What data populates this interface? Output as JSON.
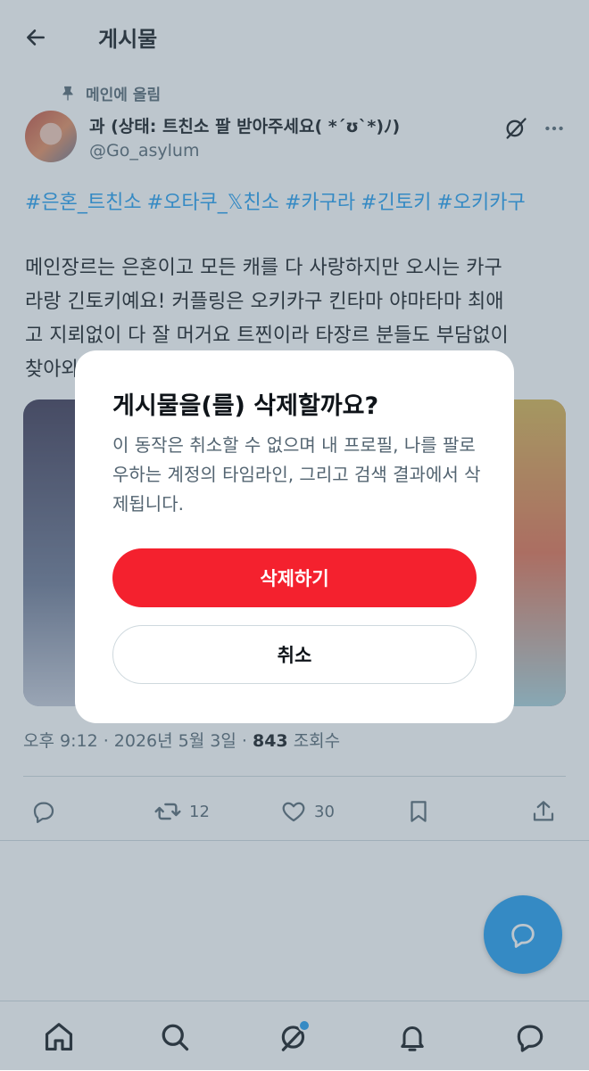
{
  "header": {
    "title": "게시물"
  },
  "post": {
    "pinned_label": "메인에 올림",
    "display_name": "과 (상태: 트친소 팔 받아주세요( *´ʊ`*)ﾉ)",
    "handle": "@Go_asylum",
    "hashtags": [
      "#은혼_트친소",
      "#오타쿠_𝕏친소",
      "#카구라",
      "#긴토키",
      "#오키카구"
    ],
    "body_lines": [
      "메인장르는 은혼이고 모든 캐를 다 사랑하지만 오시는 카구",
      "라랑 긴토키예요! 커플링은 오키카구 킨타마 야마타마 최애",
      "고 지뢰없이 다 잘 머거요 트찐이라 타장르 분들도 부담없이",
      "찾아와"
    ],
    "time": "오후 9:12",
    "date": "2026년 5월 3일",
    "views_count": "843",
    "views_label": "조회수",
    "separator": " · ",
    "retweet_count": "12",
    "like_count": "30"
  },
  "dialog": {
    "title": "게시물을(를) 삭제할까요?",
    "body": "이 동작은 취소할 수 없으며 내 프로필, 나를 팔로우하는 계정의 타임라인, 그리고 검색 결과에서 삭제됩니다.",
    "delete_label": "삭제하기",
    "cancel_label": "취소"
  },
  "colors": {
    "accent": "#1d9bf0",
    "danger": "#f4212e",
    "text": "#0f1419",
    "secondary": "#536471"
  },
  "icons": [
    "back-arrow-icon",
    "pin-icon",
    "grok-icon",
    "more-icon",
    "reply-icon",
    "retweet-icon",
    "like-icon",
    "bookmark-icon",
    "share-icon",
    "compose-reply-icon",
    "home-icon",
    "search-icon",
    "grok-nav-icon",
    "bell-icon",
    "messages-icon"
  ]
}
